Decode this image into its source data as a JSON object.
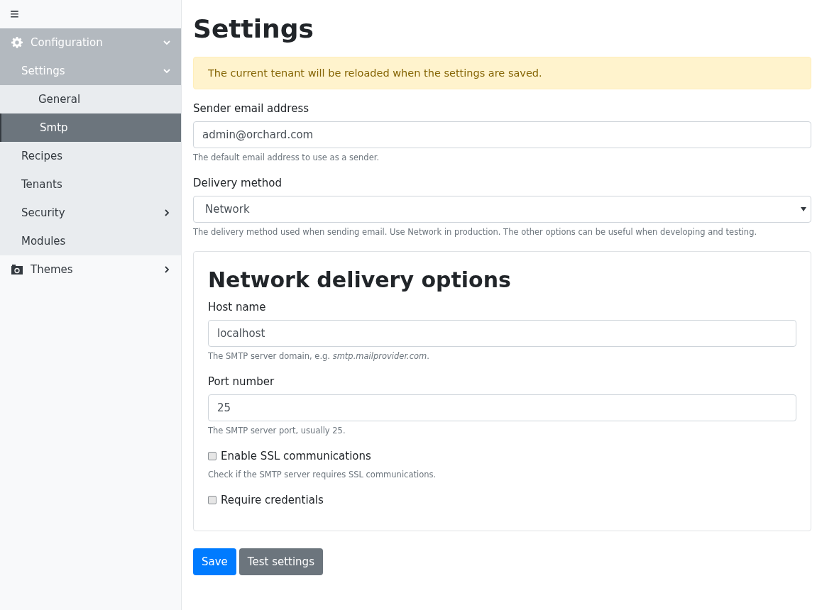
{
  "sidebar": {
    "menu_toggle": "≡",
    "items": [
      {
        "label": "Configuration",
        "expanded": true,
        "selected": false,
        "children": [
          {
            "label": "Settings",
            "expanded": true,
            "selected": false,
            "children": [
              {
                "label": "General",
                "selected": false
              },
              {
                "label": "Smtp",
                "selected": true
              }
            ]
          },
          {
            "label": "Recipes",
            "selected": false
          },
          {
            "label": "Tenants",
            "selected": false
          },
          {
            "label": "Security",
            "expandable": true,
            "expanded": false,
            "selected": false
          },
          {
            "label": "Modules",
            "selected": false
          }
        ]
      },
      {
        "label": "Themes",
        "expandable": true,
        "expanded": false,
        "selected": false
      }
    ]
  },
  "page": {
    "title": "Settings",
    "alert": "The current tenant will be reloaded when the settings are saved.",
    "sender": {
      "label": "Sender email address",
      "value": "admin@orchard.com",
      "hint": "The default email address to use as a sender."
    },
    "delivery": {
      "label": "Delivery method",
      "value": "Network",
      "hint": "The delivery method used when sending email. Use Network in production. The other options can be useful when developing and testing."
    },
    "network": {
      "title": "Network delivery options",
      "fields": [
        {
          "kind": "text",
          "label": "Host name",
          "value": "localhost",
          "hint": "The SMTP server domain, e.g. *smtp.mailprovider.com*."
        },
        {
          "kind": "text",
          "label": "Port number",
          "value": "25",
          "hint": "The SMTP server port, usually 25."
        },
        {
          "kind": "checkbox",
          "label": "Enable SSL communications",
          "checked": false,
          "hint": "Check if the SMTP server requires SSL communications."
        },
        {
          "kind": "checkbox",
          "label": "Require credentials",
          "checked": false
        }
      ]
    },
    "buttons": [
      {
        "kind": "primary",
        "label": "Save"
      },
      {
        "kind": "secondary",
        "label": "Test settings"
      }
    ]
  }
}
